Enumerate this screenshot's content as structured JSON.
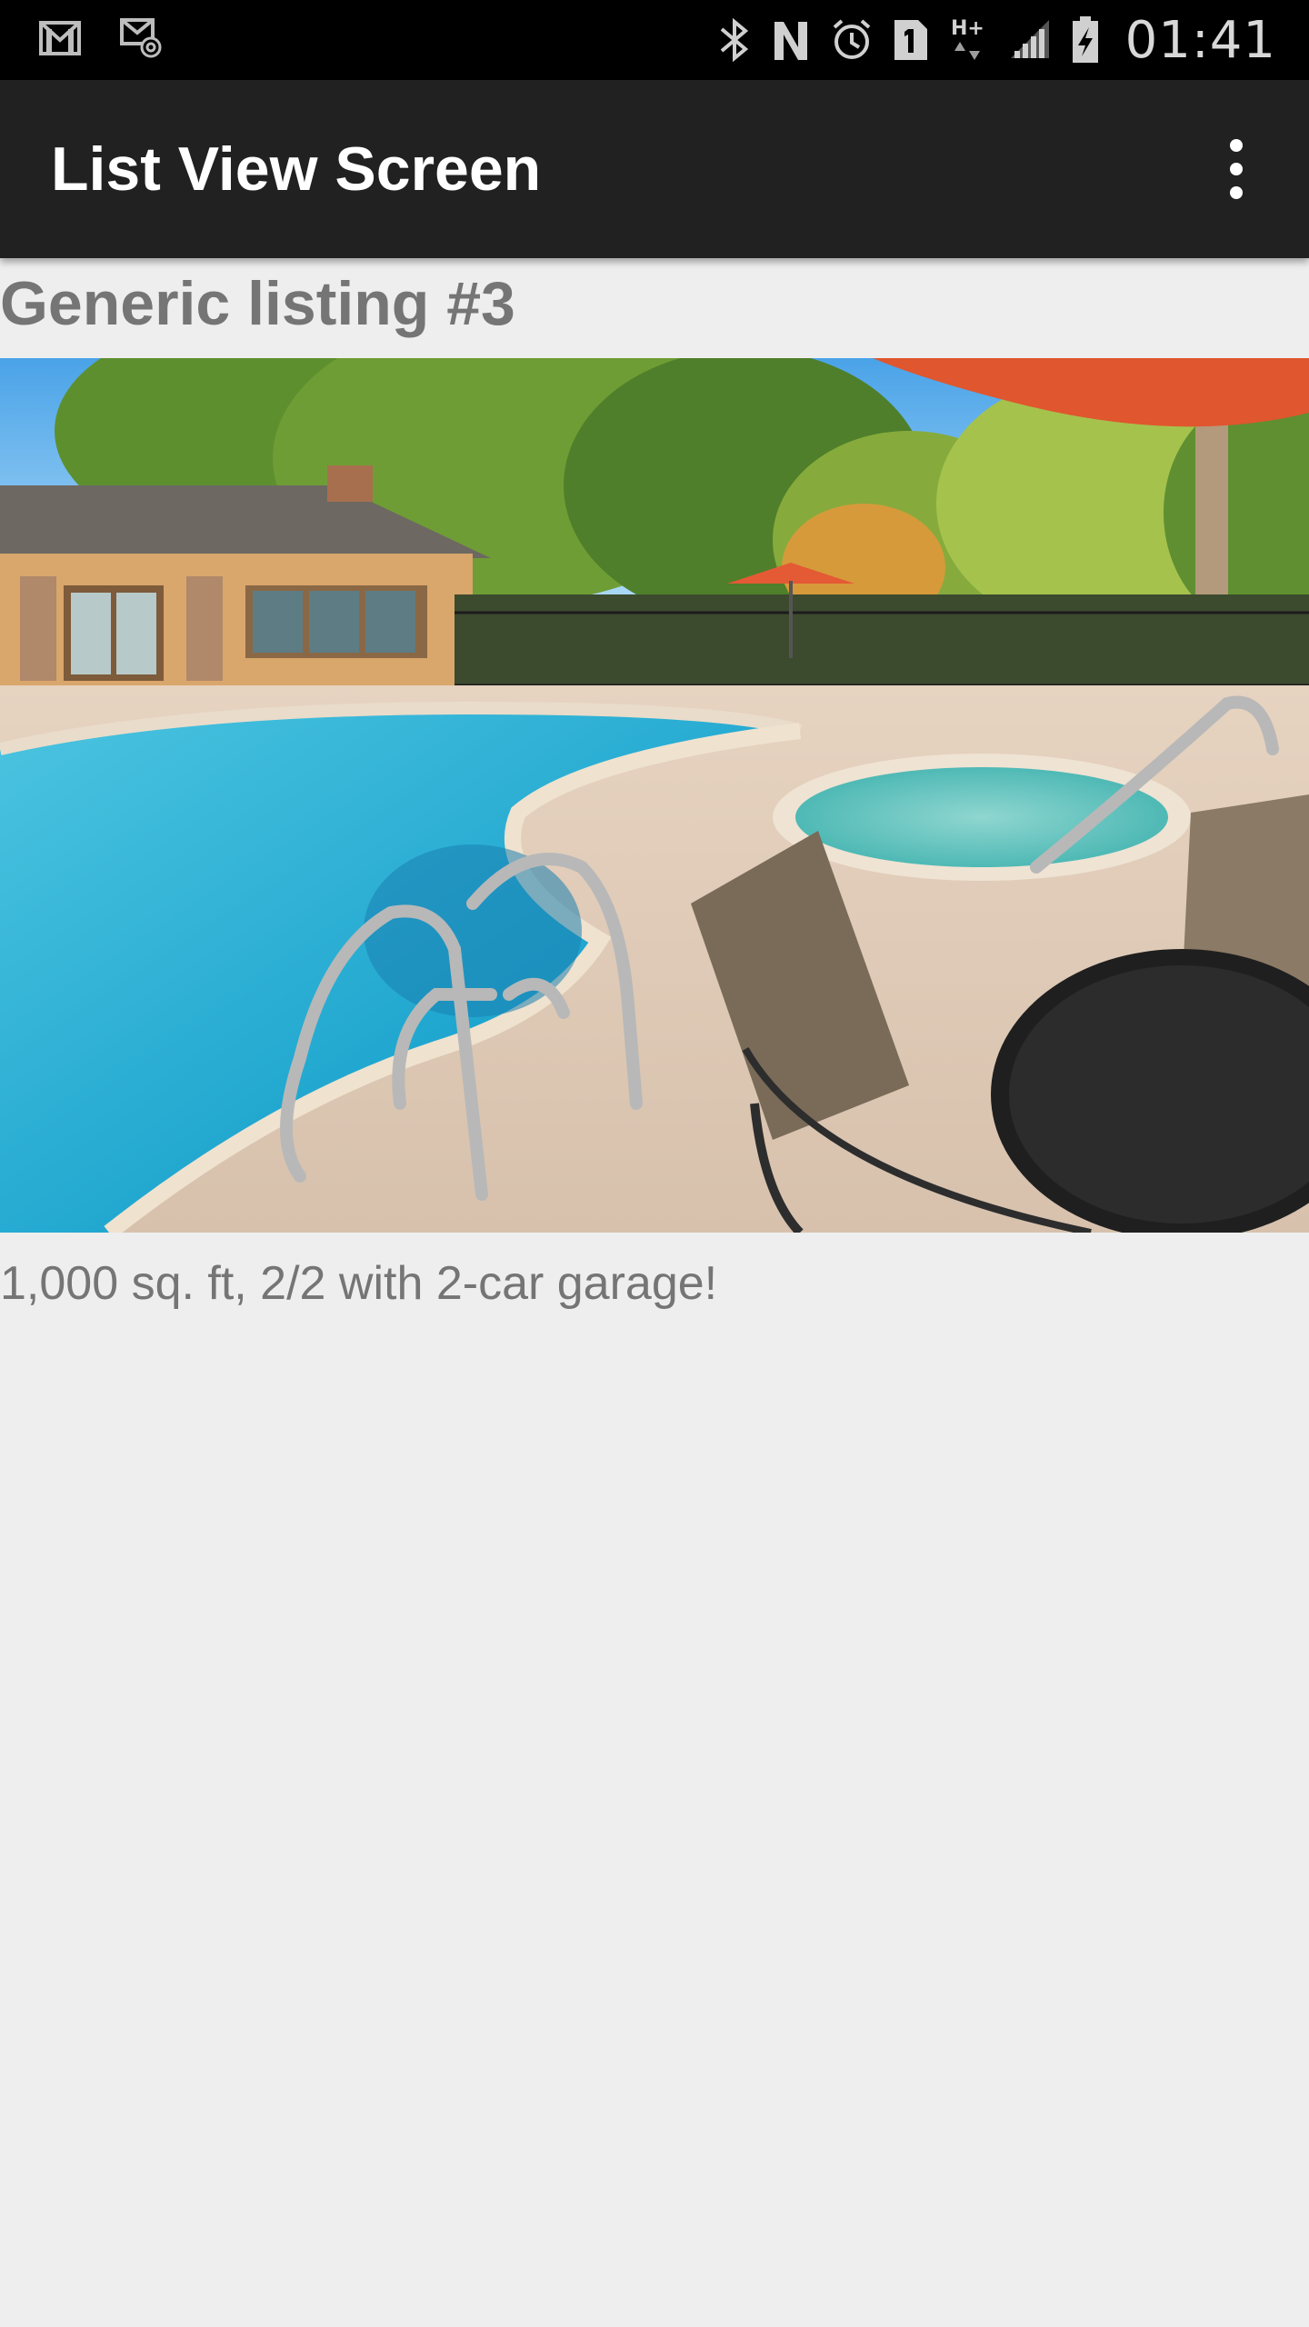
{
  "status_bar": {
    "time": "01:41",
    "left_icons": [
      "gmail-icon",
      "email-icon"
    ],
    "right_icons": [
      "bluetooth-icon",
      "nfc-icon",
      "alarm-icon",
      "sim1-icon",
      "hplus-data-icon",
      "signal-icon",
      "battery-icon"
    ]
  },
  "app_bar": {
    "title": "List View Screen",
    "menu_icon": "more-vert-icon",
    "background": "#212121"
  },
  "listing": {
    "title": "Generic listing #3",
    "image_alt": "pool-photo",
    "description": "1,000 sq. ft, 2/2 with 2-car garage!"
  },
  "colors": {
    "page_background": "#eeeeee",
    "text_secondary": "#757575",
    "status_bar": "#000000"
  }
}
